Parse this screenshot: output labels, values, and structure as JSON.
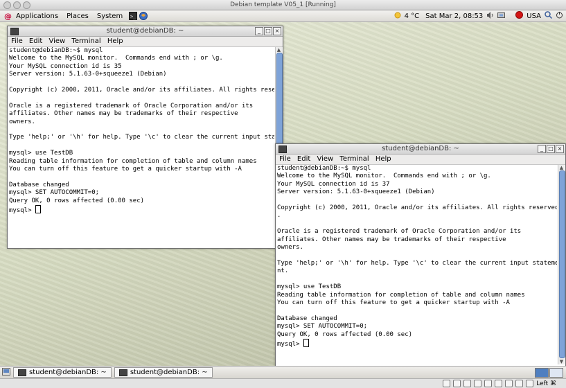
{
  "host": {
    "title": "Debian template V05_1 [Running]",
    "status_right_key": "Left ⌘"
  },
  "top_panel": {
    "menus": [
      "Applications",
      "Places",
      "System"
    ],
    "weather": "4 °C",
    "datetime": "Sat Mar  2, 08:53",
    "keyboard": "USA"
  },
  "terminals": [
    {
      "title": "student@debianDB: ~",
      "menu": [
        "File",
        "Edit",
        "View",
        "Terminal",
        "Help"
      ],
      "lines": [
        "student@debianDB:~$ mysql",
        "Welcome to the MySQL monitor.  Commands end with ; or \\g.",
        "Your MySQL connection id is 35",
        "Server version: 5.1.63-0+squeeze1 (Debian)",
        "",
        "Copyright (c) 2000, 2011, Oracle and/or its affiliates. All rights rese",
        "",
        "Oracle is a registered trademark of Oracle Corporation and/or its",
        "affiliates. Other names may be trademarks of their respective",
        "owners.",
        "",
        "Type 'help;' or '\\h' for help. Type '\\c' to clear the current input sta",
        "",
        "mysql> use TestDB",
        "Reading table information for completion of table and column names",
        "You can turn off this feature to get a quicker startup with -A",
        "",
        "Database changed",
        "mysql> SET AUTOCOMMIT=0;",
        "Query OK, 0 rows affected (0.00 sec)",
        ""
      ],
      "prompt": "mysql> "
    },
    {
      "title": "student@debianDB: ~",
      "menu": [
        "File",
        "Edit",
        "View",
        "Terminal",
        "Help"
      ],
      "lines": [
        "student@debianDB:~$ mysql",
        "Welcome to the MySQL monitor.  Commands end with ; or \\g.",
        "Your MySQL connection id is 37",
        "Server version: 5.1.63-0+squeeze1 (Debian)",
        "",
        "Copyright (c) 2000, 2011, Oracle and/or its affiliates. All rights reserved",
        ".",
        "",
        "Oracle is a registered trademark of Oracle Corporation and/or its",
        "affiliates. Other names may be trademarks of their respective",
        "owners.",
        "",
        "Type 'help;' or '\\h' for help. Type '\\c' to clear the current input stateme",
        "nt.",
        "",
        "mysql> use TestDB",
        "Reading table information for completion of table and column names",
        "You can turn off this feature to get a quicker startup with -A",
        "",
        "Database changed",
        "mysql> SET AUTOCOMMIT=0;",
        "Query OK, 0 rows affected (0.00 sec)",
        ""
      ],
      "prompt": "mysql> "
    }
  ],
  "taskbar": {
    "items": [
      "student@debianDB: ~",
      "student@debianDB: ~"
    ]
  }
}
